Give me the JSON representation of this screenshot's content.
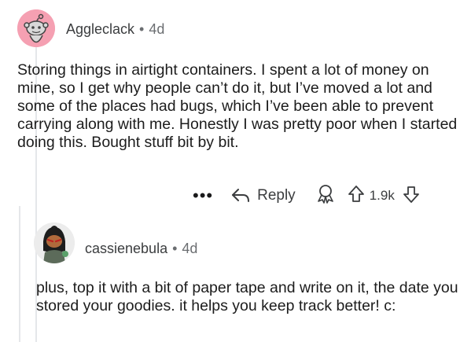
{
  "comment": {
    "author": "Aggleclack",
    "separator": "•",
    "age": "4d",
    "body": "Storing things in airtight containers. I spent a lot of money on mine, so I get why people can’t do it, but I’ve moved a lot and some of the places had bugs, which I’ve been able to prevent carrying along with me. Honestly I was pretty poor when I started doing this. Bought stuff bit by bit.",
    "actions": {
      "more": "•••",
      "reply_label": "Reply",
      "score": "1.9k"
    }
  },
  "reply": {
    "author": "cassienebula",
    "separator": "•",
    "age": "4d",
    "body": "plus, top it with a bit of paper tape and write on it, the date you stored your goodies. it helps you keep track better! c:"
  },
  "icons": {
    "avatar1": "reddit-snoo-avatar",
    "avatar2": "custom-snoo-avatar",
    "reply": "reply-arrow-icon",
    "award": "award-icon",
    "upvote": "upvote-arrow-icon",
    "downvote": "downvote-arrow-icon"
  }
}
